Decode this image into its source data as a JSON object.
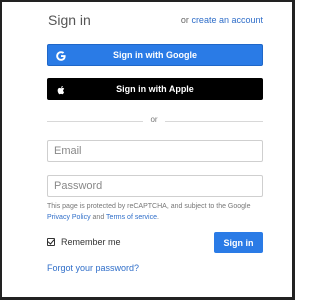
{
  "header": {
    "title": "Sign in",
    "or_text": "or",
    "create_account_link": "create an account"
  },
  "social": {
    "google_label": "Sign in with Google",
    "google_icon": "google-icon",
    "apple_label": "Sign in with Apple",
    "apple_icon": "apple-icon"
  },
  "divider": {
    "text": "or"
  },
  "form": {
    "email_placeholder": "Email",
    "email_value": "",
    "password_placeholder": "Password",
    "password_value": "",
    "notice_prefix": "This page is protected by reCAPTCHA, and subject to the Google",
    "privacy_link": "Privacy Policy",
    "notice_and": "and",
    "terms_link": "Terms of service",
    "notice_suffix": ".",
    "remember_label": "Remember me",
    "remember_checked": true,
    "signin_label": "Sign in",
    "forgot_link": "Forgot your password?"
  },
  "colors": {
    "accent": "#2a7be6",
    "link": "#2f6ec9",
    "apple_button": "#000000"
  }
}
